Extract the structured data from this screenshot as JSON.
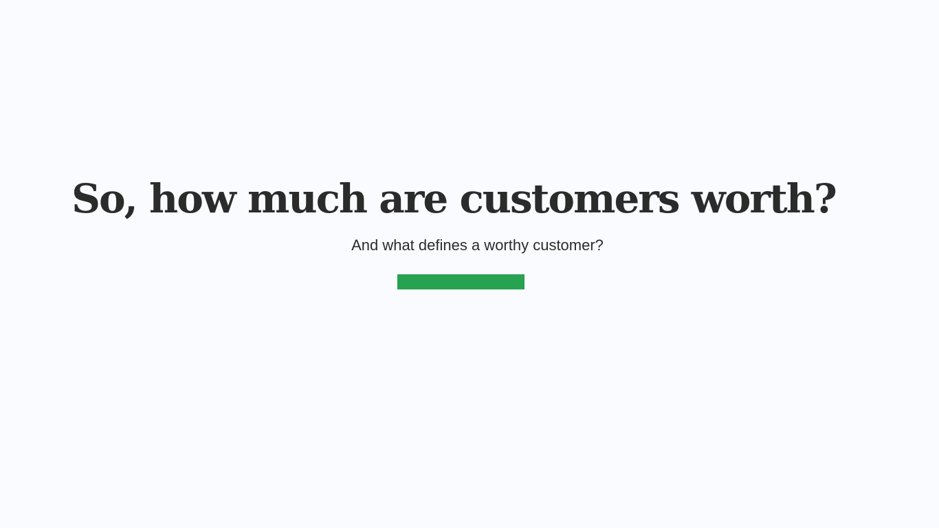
{
  "slide": {
    "title": "So, how much are customers worth?",
    "subtitle": "And what defines a worthy customer?",
    "colors": {
      "background": "#f9fbff",
      "text": "#2b2b2b",
      "accent": "#26a251"
    }
  }
}
